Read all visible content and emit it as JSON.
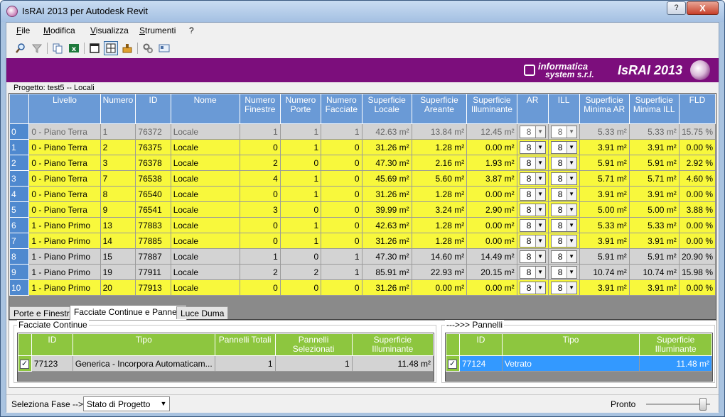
{
  "window": {
    "title": "IsRAI 2013 per Autodesk Revit",
    "help_label": "?",
    "close_label": "X"
  },
  "menu": [
    "File",
    "Modifica",
    "Visualizza",
    "Strumenti",
    "?"
  ],
  "icons": [
    "magnifier-icon",
    "funnel-icon",
    "copy-icon",
    "excel-icon",
    "window-single-icon",
    "window-grid-icon",
    "stamp-icon",
    "gears-icon",
    "card-icon"
  ],
  "banner": {
    "company_line1": "informatica",
    "company_line2": "system s.r.l.",
    "product": "IsRAI 2013",
    "color": "#7c0e7c"
  },
  "project_label": "Progetto: test5  -- Locali",
  "grid": {
    "columns": [
      "Livello",
      "Numero",
      "ID",
      "Nome",
      "Numero Finestre",
      "Numero Porte",
      "Numero Facciate",
      "Superficie Locale",
      "Superficie Areante",
      "Superficie Illuminante",
      "AR",
      "ILL",
      "Superficie Minima AR",
      "Superficie Minima ILL",
      "FLD"
    ],
    "header_color": "#6a9ad6",
    "rows": [
      {
        "idx": "0",
        "style": "first",
        "livello": "0 - Piano Terra",
        "numero": "1",
        "id": "76372",
        "nome": "Locale",
        "finestre": "1",
        "porte": "1",
        "facciate": "1",
        "sup_locale": "42.63 m²",
        "sup_areante": "13.84 m²",
        "sup_ill": "12.45 m²",
        "ar": "8",
        "ill": "8",
        "min_ar": "5.33 m²",
        "min_ill": "5.33 m²",
        "fld": "15.75 %"
      },
      {
        "idx": "1",
        "style": "yellow",
        "livello": "0 - Piano Terra",
        "numero": "2",
        "id": "76375",
        "nome": "Locale",
        "finestre": "0",
        "porte": "1",
        "facciate": "0",
        "sup_locale": "31.26 m²",
        "sup_areante": "1.28 m²",
        "sup_ill": "0.00 m²",
        "ar": "8",
        "ill": "8",
        "min_ar": "3.91 m²",
        "min_ill": "3.91 m²",
        "fld": "0.00 %"
      },
      {
        "idx": "2",
        "style": "yellow",
        "livello": "0 - Piano Terra",
        "numero": "3",
        "id": "76378",
        "nome": "Locale",
        "finestre": "2",
        "porte": "0",
        "facciate": "0",
        "sup_locale": "47.30 m²",
        "sup_areante": "2.16 m²",
        "sup_ill": "1.93 m²",
        "ar": "8",
        "ill": "8",
        "min_ar": "5.91 m²",
        "min_ill": "5.91 m²",
        "fld": "2.92 %"
      },
      {
        "idx": "3",
        "style": "yellow",
        "livello": "0 - Piano Terra",
        "numero": "7",
        "id": "76538",
        "nome": "Locale",
        "finestre": "4",
        "porte": "1",
        "facciate": "0",
        "sup_locale": "45.69 m²",
        "sup_areante": "5.60 m²",
        "sup_ill": "3.87 m²",
        "ar": "8",
        "ill": "8",
        "min_ar": "5.71 m²",
        "min_ill": "5.71 m²",
        "fld": "4.60 %"
      },
      {
        "idx": "4",
        "style": "yellow",
        "livello": "0 - Piano Terra",
        "numero": "8",
        "id": "76540",
        "nome": "Locale",
        "finestre": "0",
        "porte": "1",
        "facciate": "0",
        "sup_locale": "31.26 m²",
        "sup_areante": "1.28 m²",
        "sup_ill": "0.00 m²",
        "ar": "8",
        "ill": "8",
        "min_ar": "3.91 m²",
        "min_ill": "3.91 m²",
        "fld": "0.00 %"
      },
      {
        "idx": "5",
        "style": "yellow",
        "livello": "0 - Piano Terra",
        "numero": "9",
        "id": "76541",
        "nome": "Locale",
        "finestre": "3",
        "porte": "0",
        "facciate": "0",
        "sup_locale": "39.99 m²",
        "sup_areante": "3.24 m²",
        "sup_ill": "2.90 m²",
        "ar": "8",
        "ill": "8",
        "min_ar": "5.00 m²",
        "min_ill": "5.00 m²",
        "fld": "3.88 %"
      },
      {
        "idx": "6",
        "style": "yellow",
        "livello": "1 - Piano Primo",
        "numero": "13",
        "id": "77883",
        "nome": "Locale",
        "finestre": "0",
        "porte": "1",
        "facciate": "0",
        "sup_locale": "42.63 m²",
        "sup_areante": "1.28 m²",
        "sup_ill": "0.00 m²",
        "ar": "8",
        "ill": "8",
        "min_ar": "5.33 m²",
        "min_ill": "5.33 m²",
        "fld": "0.00 %"
      },
      {
        "idx": "7",
        "style": "yellow",
        "livello": "1 - Piano Primo",
        "numero": "14",
        "id": "77885",
        "nome": "Locale",
        "finestre": "0",
        "porte": "1",
        "facciate": "0",
        "sup_locale": "31.26 m²",
        "sup_areante": "1.28 m²",
        "sup_ill": "0.00 m²",
        "ar": "8",
        "ill": "8",
        "min_ar": "3.91 m²",
        "min_ill": "3.91 m²",
        "fld": "0.00 %"
      },
      {
        "idx": "8",
        "style": "gray",
        "livello": "1 - Piano Primo",
        "numero": "15",
        "id": "77887",
        "nome": "Locale",
        "finestre": "1",
        "porte": "0",
        "facciate": "1",
        "sup_locale": "47.30 m²",
        "sup_areante": "14.60 m²",
        "sup_ill": "14.49 m²",
        "ar": "8",
        "ill": "8",
        "min_ar": "5.91 m²",
        "min_ill": "5.91 m²",
        "fld": "20.90 %"
      },
      {
        "idx": "9",
        "style": "gray",
        "livello": "1 - Piano Primo",
        "numero": "19",
        "id": "77911",
        "nome": "Locale",
        "finestre": "2",
        "porte": "2",
        "facciate": "1",
        "sup_locale": "85.91 m²",
        "sup_areante": "22.93 m²",
        "sup_ill": "20.15 m²",
        "ar": "8",
        "ill": "8",
        "min_ar": "10.74 m²",
        "min_ill": "10.74 m²",
        "fld": "15.98 %"
      },
      {
        "idx": "10",
        "style": "yellow",
        "livello": "1 - Piano Primo",
        "numero": "20",
        "id": "77913",
        "nome": "Locale",
        "finestre": "0",
        "porte": "0",
        "facciate": "0",
        "sup_locale": "31.26 m²",
        "sup_areante": "0.00 m²",
        "sup_ill": "0.00 m²",
        "ar": "8",
        "ill": "8",
        "min_ar": "3.91 m²",
        "min_ill": "3.91 m²",
        "fld": "0.00 %"
      }
    ]
  },
  "tabs": [
    {
      "label": "Porte e Finestre",
      "active": false
    },
    {
      "label": "Facciate Continue e Pannelli",
      "active": true
    },
    {
      "label": "Luce Duma",
      "active": false
    }
  ],
  "facciate": {
    "title": "Facciate Continue",
    "columns": [
      "ID",
      "Tipo",
      "Pannelli Totali",
      "Pannelli Selezionati",
      "Superficie Illuminante"
    ],
    "rows": [
      {
        "checked": true,
        "id": "77123",
        "tipo": "Generica - Incorpora Automaticam...",
        "totali": "1",
        "selezionati": "1",
        "sup": "11.48 m²"
      }
    ]
  },
  "pannelli": {
    "title": "--->>> Pannelli",
    "columns": [
      "ID",
      "Tipo",
      "Superficie Illuminante"
    ],
    "rows": [
      {
        "checked": true,
        "id": "77124",
        "tipo": "Vetrato",
        "sup": "11.48 m²"
      }
    ]
  },
  "status": {
    "fase_label": "Seleziona Fase -->",
    "fase_value": "Stato di Progetto",
    "text": "Pronto"
  }
}
